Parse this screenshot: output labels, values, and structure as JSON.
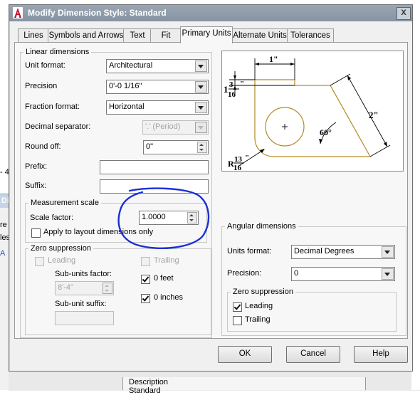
{
  "dialog": {
    "title": "Modify Dimension Style: Standard",
    "close_label": "X"
  },
  "tabs": [
    {
      "label": "Lines"
    },
    {
      "label": "Symbols and Arrows"
    },
    {
      "label": "Text"
    },
    {
      "label": "Fit"
    },
    {
      "label": "Primary Units",
      "active": true
    },
    {
      "label": "Alternate Units"
    },
    {
      "label": "Tolerances"
    }
  ],
  "linear": {
    "group_label": "Linear dimensions",
    "unit_format_label": "Unit format:",
    "unit_format_value": "Architectural",
    "precision_label": "Precision",
    "precision_value": "0'-0 1/16\"",
    "fraction_format_label": "Fraction format:",
    "fraction_format_value": "Horizontal",
    "decimal_separator_label": "Decimal separator:",
    "decimal_separator_value": "'.' (Period)",
    "round_off_label": "Round off:",
    "round_off_value": "0\"",
    "prefix_label": "Prefix:",
    "prefix_value": "",
    "suffix_label": "Suffix:",
    "suffix_value": ""
  },
  "measurement": {
    "group_label": "Measurement scale",
    "scale_factor_label": "Scale factor:",
    "scale_factor_value": "1.0000",
    "apply_layout_label": "Apply to layout dimensions only",
    "apply_layout_checked": false
  },
  "zero_linear": {
    "group_label": "Zero suppression",
    "leading_label": "Leading",
    "trailing_label": "Trailing",
    "subunits_factor_label": "Sub-units factor:",
    "subunits_factor_value": "8'-4\"",
    "subunit_suffix_label": "Sub-unit suffix:",
    "zero_feet_label": "0 feet",
    "zero_feet_checked": true,
    "zero_inches_label": "0 inches",
    "zero_inches_checked": true
  },
  "preview": {
    "dim_top": "1\"",
    "dim_left_whole": "1",
    "dim_left_num": "3",
    "dim_left_den": "16",
    "dim_left_unit": "\"",
    "dim_right": "2\"",
    "dim_angle": "60°",
    "dim_radius_prefix": "R",
    "dim_radius_num": "13",
    "dim_radius_den": "16",
    "dim_radius_unit": "\""
  },
  "angular": {
    "group_label": "Angular dimensions",
    "units_format_label": "Units format:",
    "units_format_value": "Decimal Degrees",
    "precision_label": "Precision:",
    "precision_value": "0",
    "zero_group_label": "Zero suppression",
    "leading_label": "Leading",
    "leading_checked": true,
    "trailing_label": "Trailing",
    "trailing_checked": false
  },
  "buttons": {
    "ok": "OK",
    "cancel": "Cancel",
    "help": "Help"
  },
  "background": {
    "left_fragment_1": "- 4",
    "left_fragment_2": "Di",
    "left_fragment_3": "re",
    "left_fragment_4": "les",
    "left_fragment_5": "A",
    "description_header": "Description",
    "description_value": "Standard"
  },
  "annotation": {
    "circle_color": "#1c2fd6"
  },
  "colors": {
    "title_red": "#c8102e",
    "preview_outline": "#b58b1e"
  }
}
